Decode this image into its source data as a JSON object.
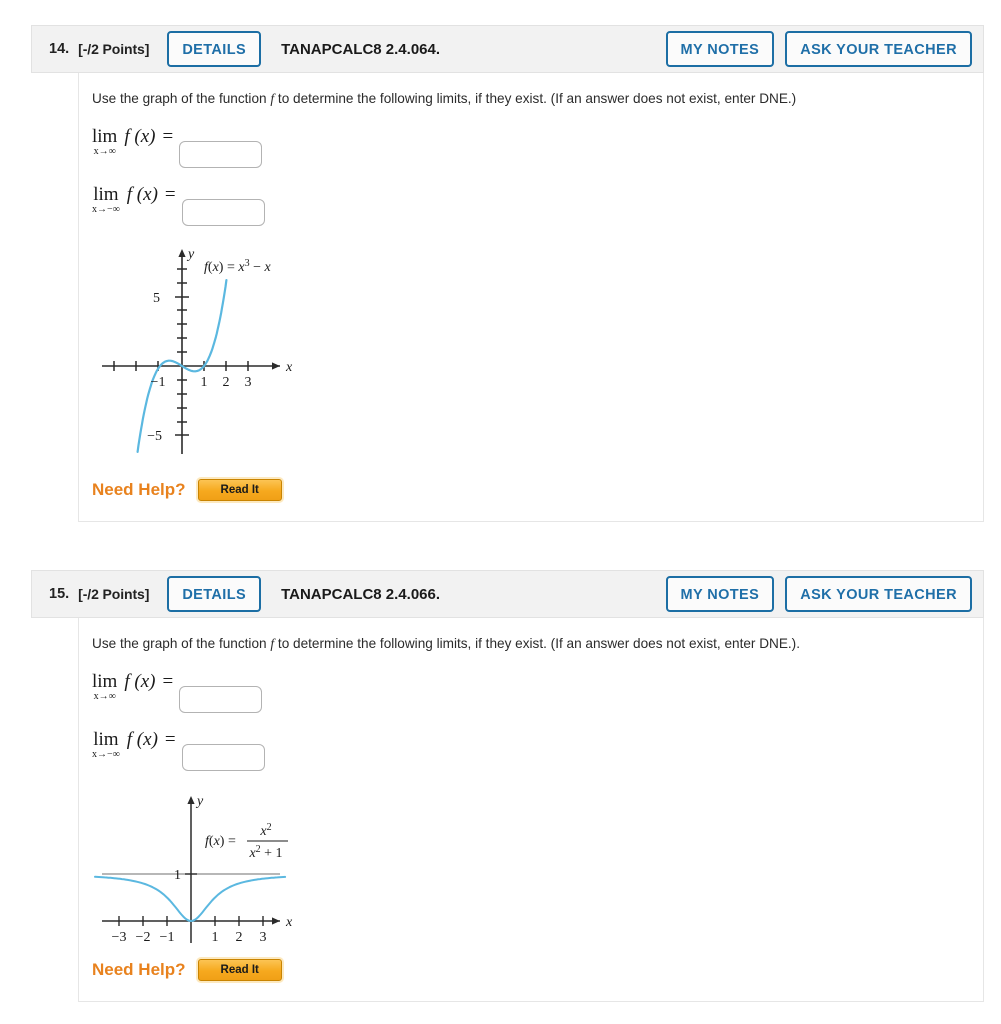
{
  "questions": [
    {
      "number": "14.",
      "points": "[-/2 Points]",
      "details_label": "DETAILS",
      "title": "TANAPCALC8 2.4.064.",
      "my_notes_label": "MY NOTES",
      "ask_teacher_label": "ASK YOUR TEACHER",
      "prompt_before": "Use the graph of the function ",
      "prompt_var": "f",
      "prompt_after": " to determine the following limits, if they exist. (If an answer does not exist, enter DNE.)",
      "limits": [
        {
          "word": "lim",
          "sub": "x→∞",
          "fn": "f (x)",
          "eq": "=",
          "value": "",
          "placeholder": ""
        },
        {
          "word": "lim",
          "sub": "x→−∞",
          "fn": "f (x)",
          "eq": "=",
          "value": "",
          "placeholder": ""
        }
      ],
      "need_help_label": "Need Help?",
      "read_it_label": "Read It",
      "graph": {
        "function_label": "f(x) = x³ − x",
        "x_axis_label": "x",
        "y_axis_label": "y",
        "x_ticks": [
          "−1",
          "1",
          "2",
          "3"
        ],
        "y_ticks": [
          "5",
          "−5"
        ],
        "curve_color": "#5bb8e0"
      }
    },
    {
      "number": "15.",
      "points": "[-/2 Points]",
      "details_label": "DETAILS",
      "title": "TANAPCALC8 2.4.066.",
      "my_notes_label": "MY NOTES",
      "ask_teacher_label": "ASK YOUR TEACHER",
      "prompt_before": "Use the graph of the function ",
      "prompt_var": "f",
      "prompt_after": " to determine the following limits, if they exist. (If an answer does not exist, enter DNE.).",
      "limits": [
        {
          "word": "lim",
          "sub": "x→∞",
          "fn": "f (x)",
          "eq": "=",
          "value": "",
          "placeholder": ""
        },
        {
          "word": "lim",
          "sub": "x→−∞",
          "fn": "f (x)",
          "eq": "=",
          "value": "",
          "placeholder": ""
        }
      ],
      "need_help_label": "Need Help?",
      "read_it_label": "Read It",
      "graph": {
        "function_label_lhs": "f(x) =",
        "function_numerator": "x²",
        "function_denominator": "x² + 1",
        "x_axis_label": "x",
        "y_axis_label": "y",
        "x_ticks": [
          "−3",
          "−2",
          "−1",
          "1",
          "2",
          "3"
        ],
        "y_ticks": [
          "1"
        ],
        "curve_color": "#5bb8e0",
        "asymptote_color": "#8c8c8c"
      }
    }
  ],
  "chart_data": [
    {
      "type": "line",
      "title": "f(x) = x^3 - x",
      "xlabel": "x",
      "ylabel": "y",
      "xlim": [
        -3.6,
        3.6
      ],
      "ylim": [
        -7.5,
        7.5
      ],
      "x_ticks": [
        -3,
        -2,
        -1,
        1,
        2,
        3
      ],
      "x_tick_labels": [
        "",
        "",
        "-1",
        "1",
        "2",
        "3"
      ],
      "y_ticks": [
        5,
        -5
      ],
      "y_tick_labels": [
        "5",
        "-5"
      ],
      "grid": false,
      "series": [
        {
          "name": "f(x) = x^3 - x",
          "x": [
            -2.0,
            -1.8,
            -1.6,
            -1.4,
            -1.2,
            -1.0,
            -0.8,
            -0.6,
            -0.4,
            -0.2,
            0.0,
            0.2,
            0.4,
            0.6,
            0.8,
            1.0,
            1.2,
            1.4,
            1.6,
            1.8,
            1.95
          ],
          "y": [
            -6.0,
            -4.03,
            -2.5,
            -1.34,
            -0.53,
            0.0,
            0.29,
            0.38,
            0.34,
            0.19,
            0.0,
            -0.19,
            -0.34,
            -0.38,
            -0.29,
            0.0,
            0.53,
            1.34,
            2.5,
            4.03,
            5.47
          ]
        }
      ]
    },
    {
      "type": "line",
      "title": "f(x) = x^2/(x^2+1)",
      "xlabel": "x",
      "ylabel": "y",
      "xlim": [
        -4.0,
        4.0
      ],
      "ylim": [
        -0.35,
        2.0
      ],
      "x_ticks": [
        -3,
        -2,
        -1,
        1,
        2,
        3
      ],
      "x_tick_labels": [
        "-3",
        "-2",
        "-1",
        "1",
        "2",
        "3"
      ],
      "y_ticks": [
        1
      ],
      "y_tick_labels": [
        "1"
      ],
      "grid": false,
      "series": [
        {
          "name": "f(x) = x^2/(x^2+1)",
          "x": [
            -4.0,
            -3.5,
            -3.0,
            -2.5,
            -2.0,
            -1.5,
            -1.0,
            -0.75,
            -0.5,
            -0.25,
            0.0,
            0.25,
            0.5,
            0.75,
            1.0,
            1.5,
            2.0,
            2.5,
            3.0,
            3.5,
            4.0
          ],
          "y": [
            0.941,
            0.925,
            0.9,
            0.862,
            0.8,
            0.692,
            0.5,
            0.36,
            0.2,
            0.059,
            0.0,
            0.059,
            0.2,
            0.36,
            0.5,
            0.692,
            0.8,
            0.862,
            0.9,
            0.925,
            0.941
          ]
        },
        {
          "name": "asymptote y = 1",
          "x": [
            -4.0,
            4.0
          ],
          "y": [
            1.0,
            1.0
          ]
        }
      ]
    }
  ]
}
